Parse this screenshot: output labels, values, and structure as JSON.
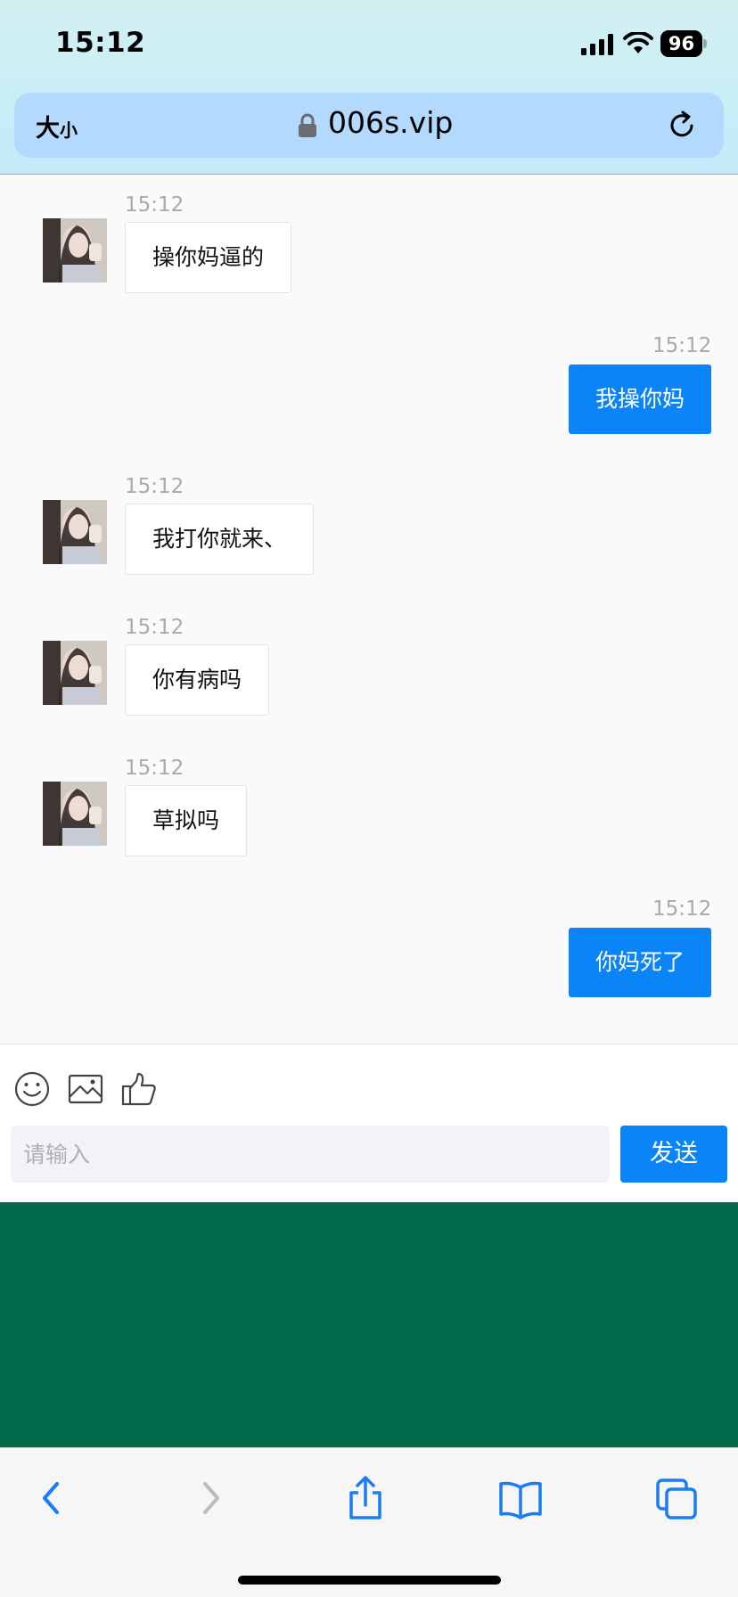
{
  "status_bar": {
    "time": "15:12",
    "battery": "96"
  },
  "browser": {
    "text_size_label": "大",
    "text_size_small": "小",
    "url": "006s.vip"
  },
  "messages": [
    {
      "direction": "incoming",
      "time": "15:12",
      "text": "操你妈逼的"
    },
    {
      "direction": "outgoing",
      "time": "15:12",
      "text": "我操你妈"
    },
    {
      "direction": "incoming",
      "time": "15:12",
      "text": "我打你就来、"
    },
    {
      "direction": "incoming",
      "time": "15:12",
      "text": "你有病吗"
    },
    {
      "direction": "incoming",
      "time": "15:12",
      "text": "草拟吗"
    },
    {
      "direction": "outgoing",
      "time": "15:12",
      "text": "你妈死了"
    }
  ],
  "composer": {
    "tools": [
      "emoji-icon",
      "image-icon",
      "thumbs-up-icon"
    ],
    "placeholder": "请输入",
    "send_label": "发送"
  },
  "toolbar": {
    "icons": [
      "back-icon",
      "forward-icon",
      "share-icon",
      "bookmarks-icon",
      "tabs-icon"
    ]
  },
  "colors": {
    "accent": "#0a84f7",
    "green_block": "#036a4b",
    "address_bar": "#b3d9fd"
  }
}
